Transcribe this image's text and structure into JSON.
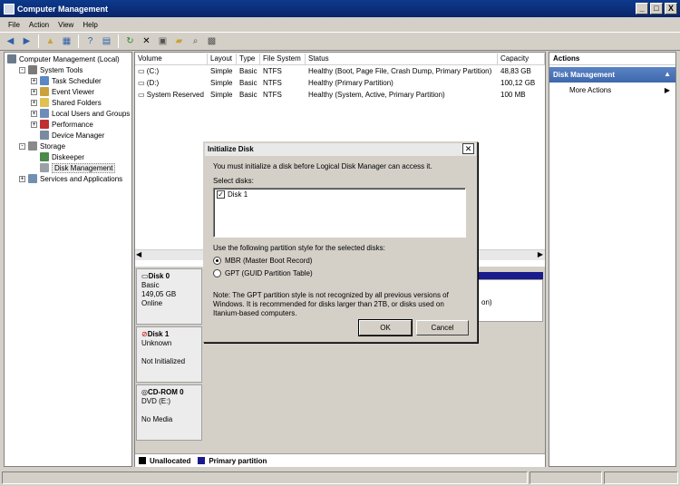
{
  "window": {
    "title": "Computer Management",
    "min": "_",
    "max": "□",
    "close": "X"
  },
  "menu": [
    "File",
    "Action",
    "View",
    "Help"
  ],
  "tree": [
    {
      "label": "Computer Management (Local)",
      "indent": 0,
      "exp": "",
      "icon": "#6c7b8c"
    },
    {
      "label": "System Tools",
      "indent": 1,
      "exp": "-",
      "icon": "#7a7a7a"
    },
    {
      "label": "Task Scheduler",
      "indent": 2,
      "exp": "+",
      "icon": "#5b87c5"
    },
    {
      "label": "Event Viewer",
      "indent": 2,
      "exp": "+",
      "icon": "#c9a23a"
    },
    {
      "label": "Shared Folders",
      "indent": 2,
      "exp": "+",
      "icon": "#e0c050"
    },
    {
      "label": "Local Users and Groups",
      "indent": 2,
      "exp": "+",
      "icon": "#6d8db8"
    },
    {
      "label": "Performance",
      "indent": 2,
      "exp": "+",
      "icon": "#c03030"
    },
    {
      "label": "Device Manager",
      "indent": 2,
      "exp": "",
      "icon": "#7a8aa0"
    },
    {
      "label": "Storage",
      "indent": 1,
      "exp": "-",
      "icon": "#8a8a8a"
    },
    {
      "label": "Diskeeper",
      "indent": 2,
      "exp": "",
      "icon": "#4a8a4a"
    },
    {
      "label": "Disk Management",
      "indent": 2,
      "exp": "",
      "icon": "#9aa0a8",
      "selected": true
    },
    {
      "label": "Services and Applications",
      "indent": 1,
      "exp": "+",
      "icon": "#7090b0"
    }
  ],
  "volumes": {
    "columns": [
      "Volume",
      "Layout",
      "Type",
      "File System",
      "Status",
      "Capacity"
    ],
    "rows": [
      [
        "(C:)",
        "Simple",
        "Basic",
        "NTFS",
        "Healthy (Boot, Page File, Crash Dump, Primary Partition)",
        "48,83 GB"
      ],
      [
        "(D:)",
        "Simple",
        "Basic",
        "NTFS",
        "Healthy (Primary Partition)",
        "100,12 GB"
      ],
      [
        "System Reserved",
        "Simple",
        "Basic",
        "NTFS",
        "Healthy (System, Active, Primary Partition)",
        "100 MB"
      ]
    ]
  },
  "disks": [
    {
      "name": "Disk 0",
      "l2": "Basic",
      "l3": "149,05 GB",
      "l4": "Online"
    },
    {
      "name": "Disk 1",
      "l2": "Unknown",
      "l3": "",
      "l4": "Not Initialized"
    },
    {
      "name": "CD-ROM 0",
      "l2": "DVD (E:)",
      "l3": "",
      "l4": "No Media"
    }
  ],
  "partial_text": "on)",
  "legend": {
    "unallocated": "Unallocated",
    "primary": "Primary partition",
    "unallocated_color": "#000000",
    "primary_color": "#1a1a8c"
  },
  "actions": {
    "header": "Actions",
    "section": "Disk Management",
    "more": "More Actions"
  },
  "dialog": {
    "title": "Initialize Disk",
    "intro": "You must initialize a disk before Logical Disk Manager can access it.",
    "select_label": "Select disks:",
    "disk_item": "Disk 1",
    "style_label": "Use the following partition style for the selected disks:",
    "mbr": "MBR (Master Boot Record)",
    "gpt": "GPT (GUID Partition Table)",
    "note1": "Note: The GPT partition style is not recognized by all previous versions of",
    "note2": "Windows. It is recommended for disks larger than 2TB, or disks used on",
    "note3": "Itanium-based computers.",
    "ok": "OK",
    "cancel": "Cancel"
  }
}
